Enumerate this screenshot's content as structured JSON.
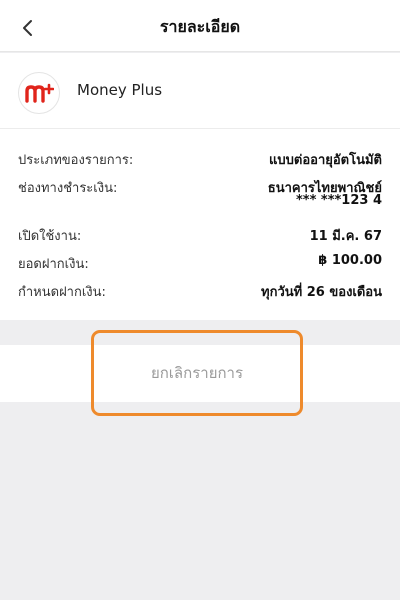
{
  "header": {
    "title": "รายละเอียด",
    "back_icon": "chevron-left-icon"
  },
  "provider": {
    "name": "Money Plus",
    "logo_text": "m",
    "logo_plus": "+",
    "brand_color": "#e0241b",
    "accent_color": "#f7a21b"
  },
  "details": {
    "type_label": "ประเภทของรายการ:",
    "type_value": "แบบต่ออายุอัตโนมัติ",
    "channel_label": "ช่องทางชำระเงิน:",
    "channel_value": "ธนาคารไทยพาณิชย์",
    "channel_account": "*** ***123 4",
    "activated_label": "เปิดใช้งาน:",
    "activated_value": "11 มี.ค. 67",
    "amount_label": "ยอดฝากเงิน:",
    "amount_value": "฿ 100.00",
    "schedule_label": "กำหนดฝากเงิน:",
    "schedule_value": "ทุกวันที่ 26 ของเดือน"
  },
  "actions": {
    "cancel_label": "ยกเลิกรายการ",
    "highlight_color": "#ee8a2c"
  }
}
